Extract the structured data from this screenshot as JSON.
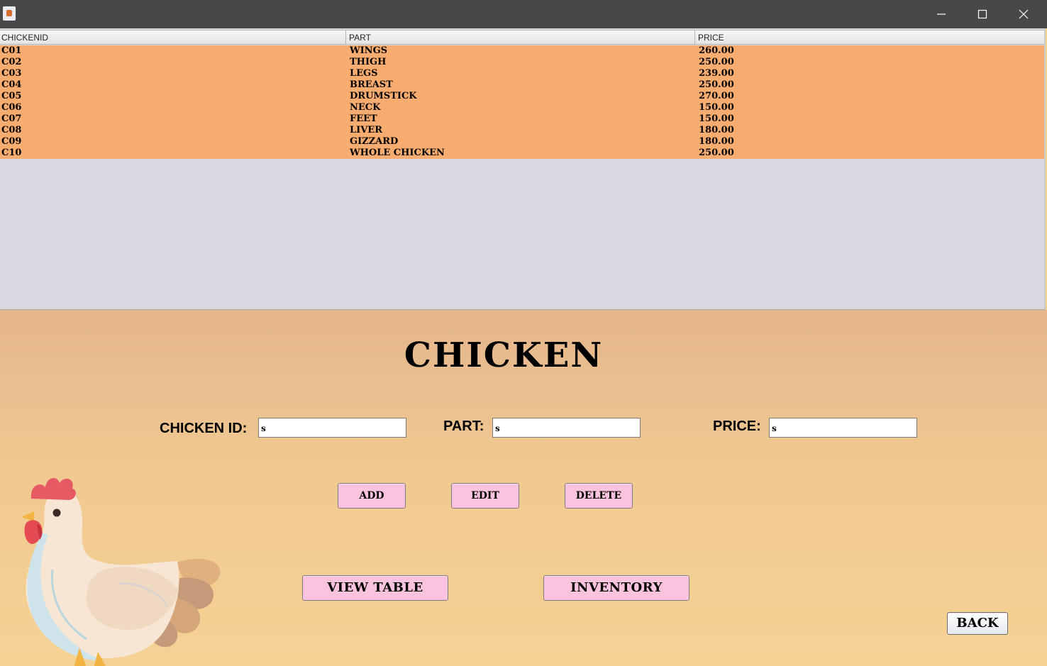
{
  "window": {
    "title": "",
    "controls": {
      "minimize": "minimize-icon",
      "maximize": "maximize-icon",
      "close": "close-icon"
    }
  },
  "table": {
    "columns": [
      "CHICKENID",
      "PART",
      "PRICE"
    ],
    "rows": [
      {
        "id": "C01",
        "part": "WINGS",
        "price": "260.00"
      },
      {
        "id": "C02",
        "part": "THIGH",
        "price": "250.00"
      },
      {
        "id": "C03",
        "part": "LEGS",
        "price": "239.00"
      },
      {
        "id": "C04",
        "part": "BREAST",
        "price": "250.00"
      },
      {
        "id": "C05",
        "part": "DRUMSTICK",
        "price": "270.00"
      },
      {
        "id": "C06",
        "part": "NECK",
        "price": "150.00"
      },
      {
        "id": "C07",
        "part": "FEET",
        "price": "150.00"
      },
      {
        "id": "C08",
        "part": "LIVER",
        "price": "180.00"
      },
      {
        "id": "C09",
        "part": "GIZZARD",
        "price": "180.00"
      },
      {
        "id": "C10",
        "part": "WHOLE CHICKEN",
        "price": "250.00"
      }
    ]
  },
  "form": {
    "title": "CHICKEN",
    "fields": {
      "chicken_id": {
        "label": "CHICKEN ID:",
        "value": "s"
      },
      "part": {
        "label": "PART:",
        "value": "s"
      },
      "price": {
        "label": "PRICE:",
        "value": "s"
      }
    },
    "buttons": {
      "add": "ADD",
      "edit": "EDIT",
      "delete": "DELETE",
      "view_table": "VIEW TABLE",
      "inventory": "INVENTORY",
      "back": "BACK"
    }
  },
  "colors": {
    "titlebar": "#484848",
    "row_background": "#f9ac6f",
    "table_empty": "#d8d9e1",
    "button_pink": "#fcc3df",
    "form_background_top": "#e5b68c",
    "form_background_bottom": "#f5d294"
  },
  "icons": {
    "app": "java-app-icon",
    "illustration": "rooster-illustration"
  }
}
